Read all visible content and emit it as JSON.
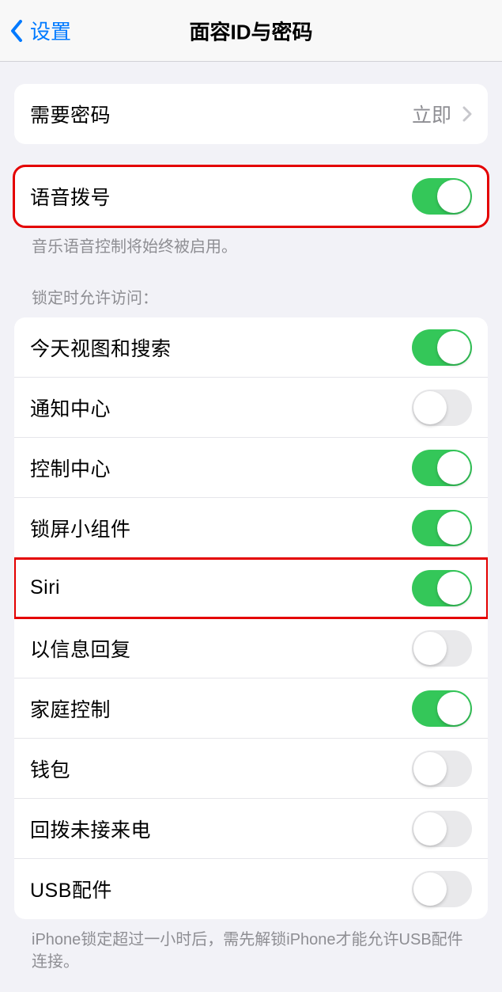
{
  "header": {
    "back_label": "设置",
    "title": "面容ID与密码"
  },
  "passcode_row": {
    "label": "需要密码",
    "value": "立即"
  },
  "voice_dial": {
    "label": "语音拨号",
    "on": true,
    "footer": "音乐语音控制将始终被启用。"
  },
  "lock_access": {
    "header": "锁定时允许访问：",
    "items": [
      {
        "label": "今天视图和搜索",
        "on": true,
        "highlight": false
      },
      {
        "label": "通知中心",
        "on": false,
        "highlight": false
      },
      {
        "label": "控制中心",
        "on": true,
        "highlight": false
      },
      {
        "label": "锁屏小组件",
        "on": true,
        "highlight": false
      },
      {
        "label": "Siri",
        "on": true,
        "highlight": true
      },
      {
        "label": "以信息回复",
        "on": false,
        "highlight": false
      },
      {
        "label": "家庭控制",
        "on": true,
        "highlight": false
      },
      {
        "label": "钱包",
        "on": false,
        "highlight": false
      },
      {
        "label": "回拨未接来电",
        "on": false,
        "highlight": false
      },
      {
        "label": "USB配件",
        "on": false,
        "highlight": false
      }
    ],
    "footer": "iPhone锁定超过一小时后，需先解锁iPhone才能允许USB配件连接。"
  }
}
